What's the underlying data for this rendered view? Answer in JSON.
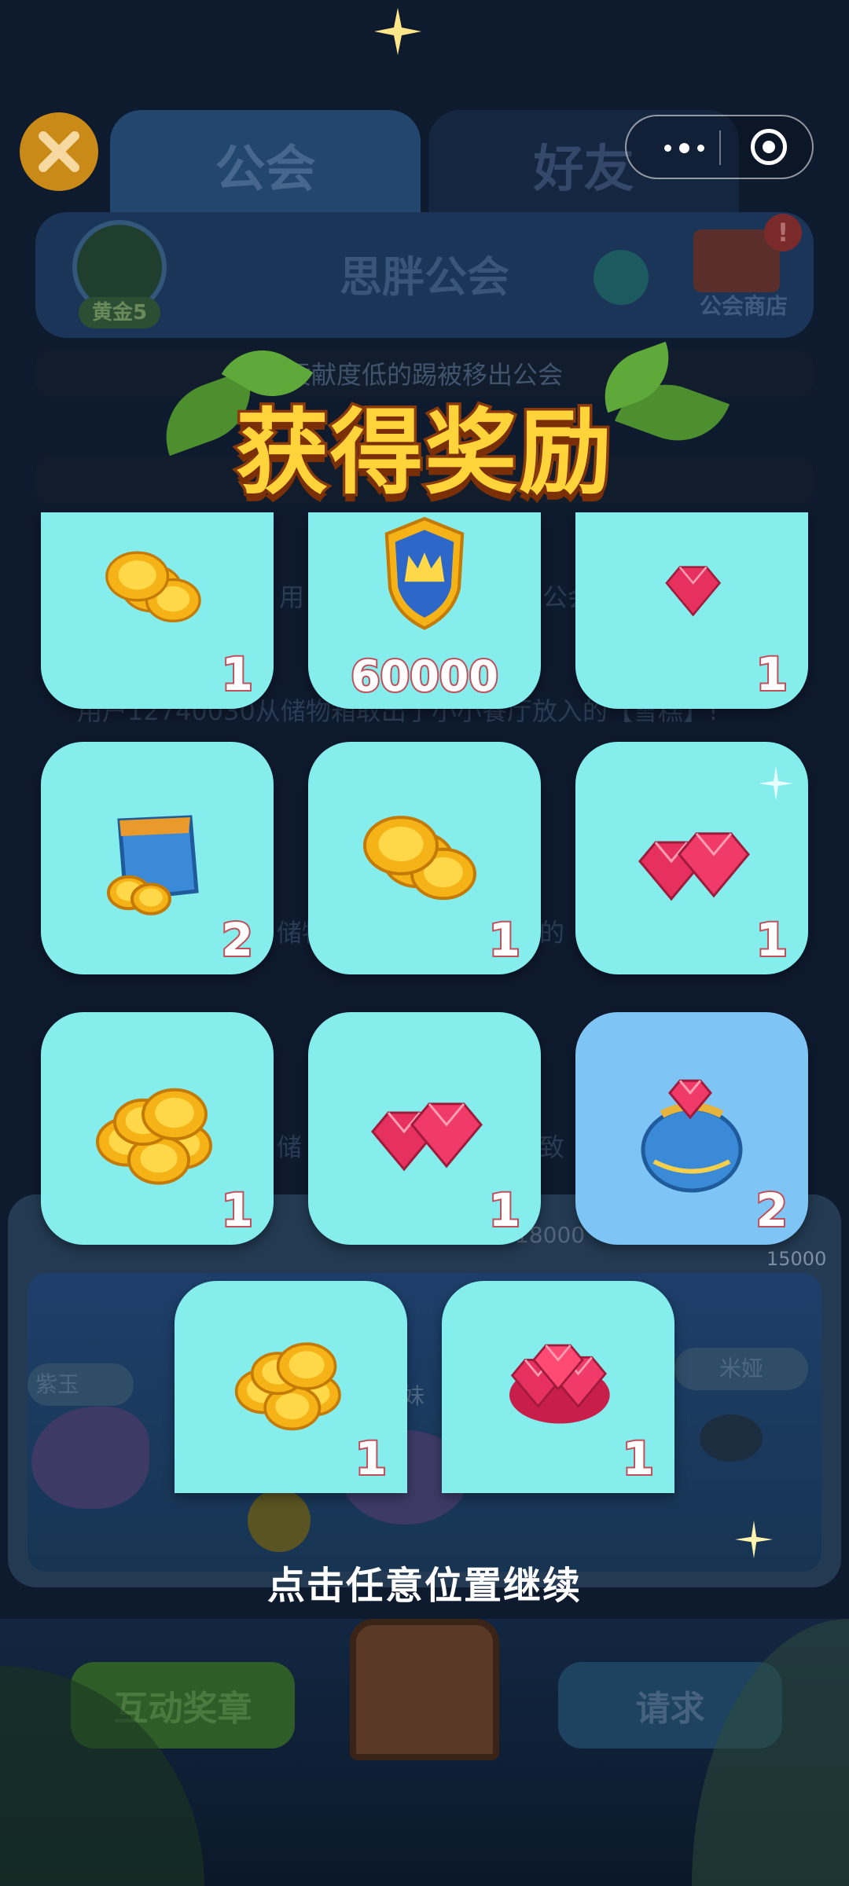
{
  "background": {
    "tabs": [
      "公会",
      "好友"
    ],
    "guild_rank": "黄金5",
    "guild_name": "思胖公会",
    "shop_label": "公会商店",
    "notice_1": "贡献度低的踢被移出公会",
    "faded_lines": [
      "用",
      "公会",
      "用户12740030从储物箱取出了小小餐厅放入的【雪糕】!",
      "储物",
      "的",
      "储",
      "致"
    ],
    "progress_text": "18000",
    "progress_max": "15000",
    "members": [
      "紫玉",
      "妹",
      "米娅"
    ],
    "buttons": [
      "互动奖章",
      "请求"
    ]
  },
  "title": "获得奖励",
  "rewards": [
    {
      "icon": "gold-coins-icon",
      "qty": "1"
    },
    {
      "icon": "crown-shield-icon",
      "qty": "60000"
    },
    {
      "icon": "ruby-gem-icon",
      "qty": "1"
    },
    {
      "icon": "coin-pouch-icon",
      "qty": "2"
    },
    {
      "icon": "gold-coins-icon",
      "qty": "1"
    },
    {
      "icon": "ruby-gems-icon",
      "qty": "1"
    },
    {
      "icon": "gold-coin-pile-icon",
      "qty": "1"
    },
    {
      "icon": "ruby-gems-icon",
      "qty": "1"
    },
    {
      "icon": "treasure-bag-icon",
      "qty": "2"
    },
    {
      "icon": "gold-coin-pile-icon",
      "qty": "1"
    },
    {
      "icon": "ruby-pile-icon",
      "qty": "1"
    }
  ],
  "continue_hint": "点击任意位置继续",
  "colors": {
    "card": "#86eded",
    "card_highlight": "#7ec4f5",
    "title_fill": "#ffd43a",
    "qty_outline": "#c0505c"
  }
}
